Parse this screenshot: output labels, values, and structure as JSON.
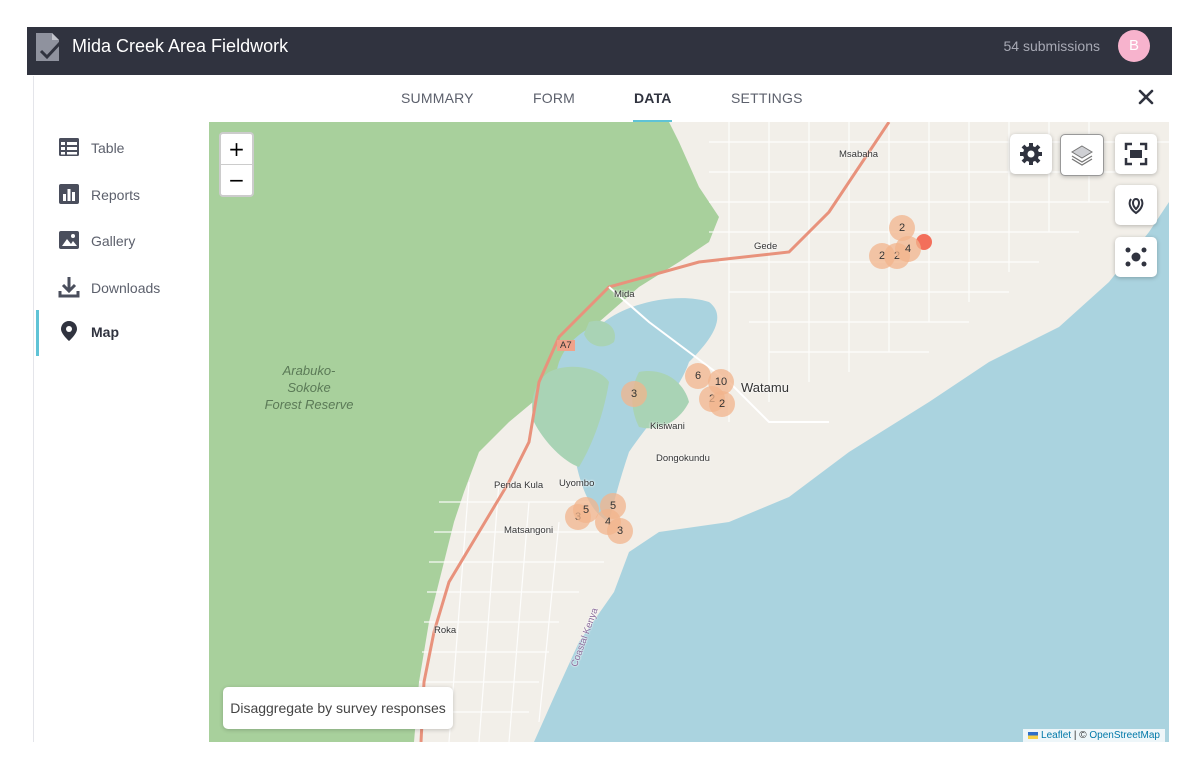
{
  "header": {
    "title": "Mida Creek Area Fieldwork",
    "submissions": "54 submissions",
    "avatar_initial": "B"
  },
  "tabs": [
    {
      "label": "SUMMARY"
    },
    {
      "label": "FORM"
    },
    {
      "label": "DATA",
      "active": true
    },
    {
      "label": "SETTINGS"
    }
  ],
  "sidebar": {
    "items": [
      {
        "label": "Table",
        "icon": "table-icon"
      },
      {
        "label": "Reports",
        "icon": "bar-chart-icon"
      },
      {
        "label": "Gallery",
        "icon": "image-icon"
      },
      {
        "label": "Downloads",
        "icon": "download-icon"
      },
      {
        "label": "Map",
        "icon": "map-pin-icon",
        "active": true
      }
    ]
  },
  "map": {
    "zoom_in": "+",
    "zoom_out": "−",
    "disaggregate_label": "Disaggregate by survey responses",
    "attribution": {
      "leaflet": "Leaflet",
      "separator": " | © ",
      "osm": "OpenStreetMap"
    },
    "forest_label": [
      "Arabuko-",
      "Sokoke",
      "Forest Reserve"
    ],
    "places": [
      "Msabaha",
      "Gede",
      "Mida",
      "A7",
      "Watamu",
      "Kisiwani",
      "Dongokundu",
      "Penda Kula",
      "Uyombo",
      "Matsangoni",
      "Roka",
      "Coastal Kenya"
    ],
    "clusters": [
      "2",
      "2",
      "2",
      "4",
      "6",
      "10",
      "3",
      "2",
      "2",
      "3",
      "5",
      "5",
      "4",
      "3"
    ],
    "colors": {
      "sea": "#aad3df",
      "forest": "#a8d09c",
      "land": "#f2efe9",
      "cluster": "#f1b48c",
      "accent": "#5fc3d6",
      "header": "#30333f"
    }
  }
}
